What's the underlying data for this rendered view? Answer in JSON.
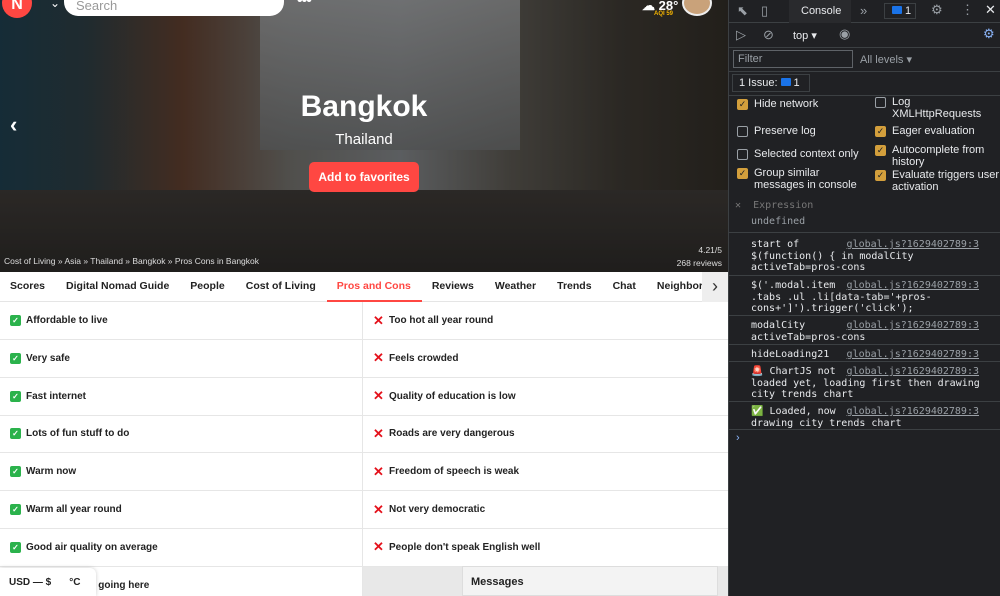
{
  "header": {
    "search_placeholder": "Search",
    "temperature": "28°",
    "aqi": "AQI 59",
    "logo_text": "N"
  },
  "hero": {
    "city": "Bangkok",
    "country": "Thailand",
    "favorite_button": "Add to favorites",
    "breadcrumb": "Cost of Living » Asia » Thailand » Bangkok » Pros Cons in Bangkok",
    "rating": "4.21/5",
    "reviews": "268 reviews"
  },
  "tabs": [
    {
      "label": "Scores"
    },
    {
      "label": "Digital Nomad Guide"
    },
    {
      "label": "People"
    },
    {
      "label": "Cost of Living"
    },
    {
      "label": "Pros and Cons",
      "active": true
    },
    {
      "label": "Reviews"
    },
    {
      "label": "Weather"
    },
    {
      "label": "Trends"
    },
    {
      "label": "Chat"
    },
    {
      "label": "Neighborhood"
    }
  ],
  "pros": [
    "Affordable to live",
    "Very safe",
    "Fast internet",
    "Lots of fun stuff to do",
    "Warm now",
    "Warm all year round",
    "Good air quality on average",
    "Members liked going here"
  ],
  "cons": [
    "Too hot all year round",
    "Feels crowded",
    "Quality of education is low",
    "Roads are very dangerous",
    "Freedom of speech is weak",
    "Not very democratic",
    "People don't speak English well"
  ],
  "footer": {
    "currency": "USD — $",
    "temp_unit": "°C",
    "messages": "Messages"
  },
  "devtools": {
    "tab": "Console",
    "issues_count": "1",
    "context": "top",
    "filter_placeholder": "Filter",
    "levels": "All levels",
    "issue_label": "1 Issue:",
    "settings": [
      {
        "label": "Hide network",
        "checked": true
      },
      {
        "label": "Log XMLHttpRequests",
        "checked": false
      },
      {
        "label": "Preserve log",
        "checked": false
      },
      {
        "label": "Eager evaluation",
        "checked": true
      },
      {
        "label": "Selected context only",
        "checked": false
      },
      {
        "label": "Autocomplete from history",
        "checked": true
      },
      {
        "label": "Group similar messages in console",
        "checked": true
      },
      {
        "label": "Evaluate triggers user activation",
        "checked": true
      }
    ],
    "expression": "Expression",
    "expression_result": "undefined",
    "logs": [
      {
        "text": "start of\n$(function() { in modalCity\nactiveTab=pros-cons",
        "source": "global.js?1629402789:3"
      },
      {
        "text": "$('.modal.item\n.tabs .ul .li[data-tab='+pros-\ncons+']').trigger('click');",
        "source": "global.js?1629402789:3"
      },
      {
        "text": "modalCity\nactiveTab=pros-cons",
        "source": "global.js?1629402789:3"
      },
      {
        "text": "hideLoading21",
        "source": "global.js?1629402789:3"
      },
      {
        "text": "🚨 ChartJS not\nloaded yet, loading first then drawing\ncity trends chart",
        "source": "global.js?1629402789:3"
      },
      {
        "text": "✅ Loaded, now\ndrawing city trends chart",
        "source": "global.js?1629402789:3"
      }
    ]
  }
}
